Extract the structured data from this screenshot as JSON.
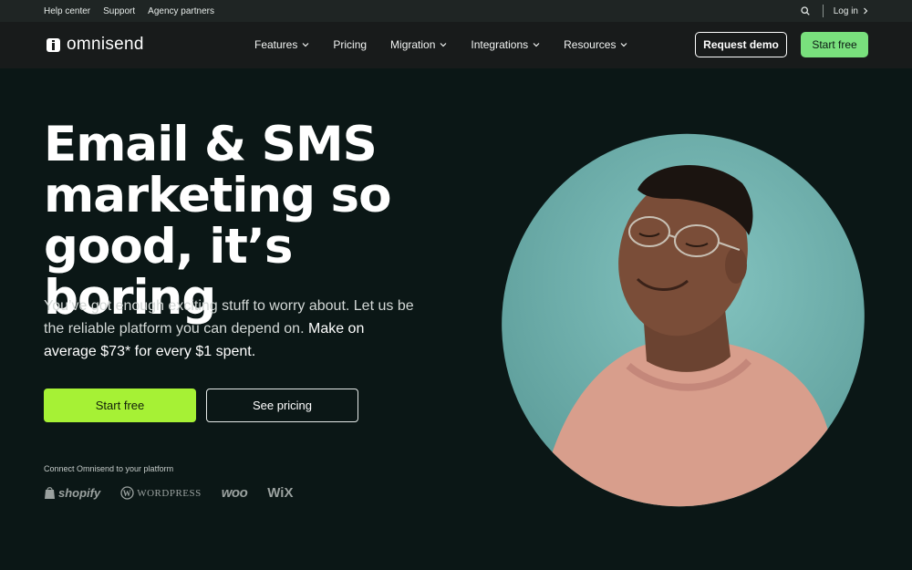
{
  "utility_bar": {
    "links": [
      "Help center",
      "Support",
      "Agency partners"
    ],
    "login_label": "Log in",
    "search_icon": "search-icon",
    "login_icon": "chevron-right-icon"
  },
  "nav": {
    "logo_text": "omnisend",
    "items": [
      {
        "label": "Features",
        "has_dropdown": true
      },
      {
        "label": "Pricing",
        "has_dropdown": false
      },
      {
        "label": "Migration",
        "has_dropdown": true
      },
      {
        "label": "Integrations",
        "has_dropdown": true
      },
      {
        "label": "Resources",
        "has_dropdown": true
      }
    ],
    "request_demo_label": "Request demo",
    "start_free_label": "Start free"
  },
  "hero": {
    "title_line1": "Email & SMS",
    "title_line2": "marketing so",
    "title_line3": "good, it’s boring",
    "subtitle_plain": "You’ve got enough exciting stuff to worry about. Let us be the reliable platform you can depend on.",
    "subtitle_bold": "Make on average $73* for every $1 spent.",
    "start_free_label": "Start free",
    "see_pricing_label": "See pricing",
    "connect_label": "Connect Omnisend to your platform",
    "platforms": [
      "shopify",
      "WordPress",
      "woo",
      "WiX"
    ]
  },
  "colors": {
    "page_bg": "#0b1716",
    "utility_bg": "#1f2524",
    "nav_bg": "#181b1b",
    "nav_cta": "#79e07d",
    "hero_cta": "#a6f135",
    "hero_image_bg": "#6fb2af"
  }
}
